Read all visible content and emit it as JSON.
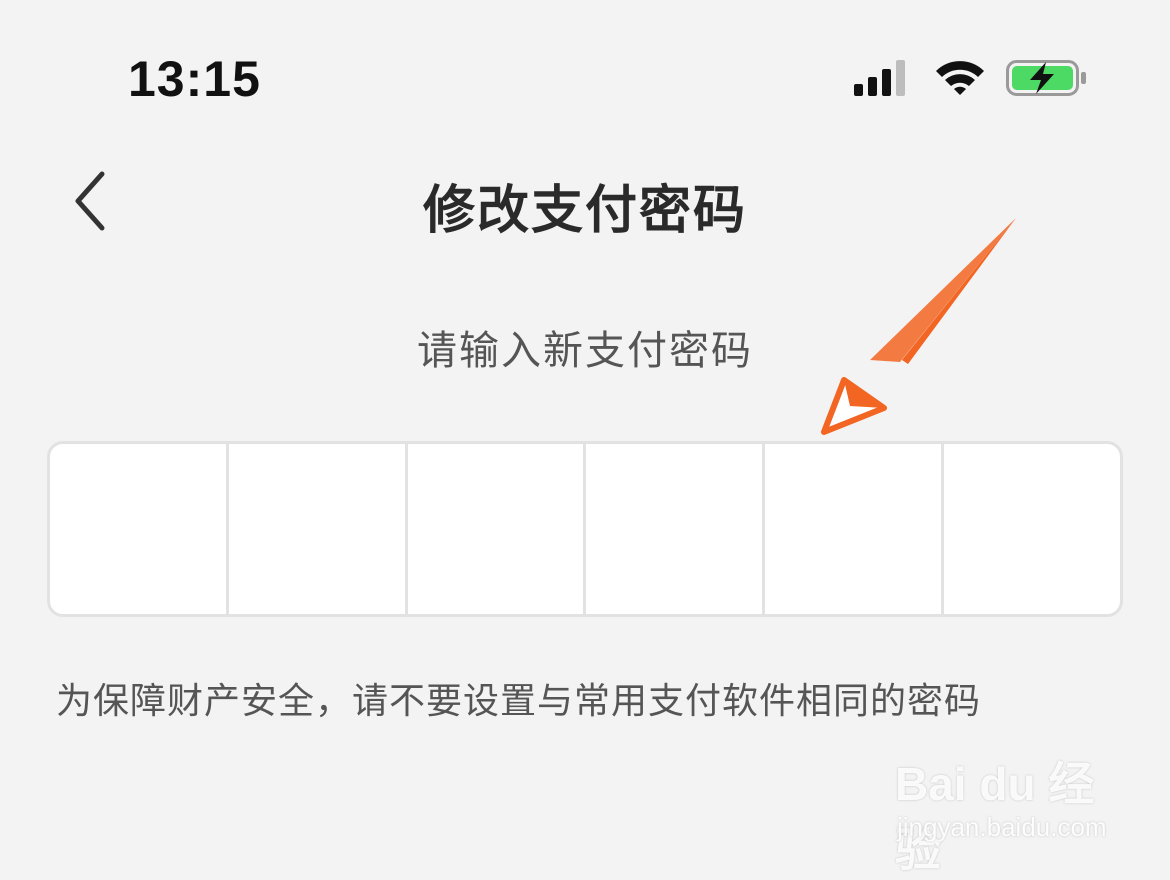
{
  "status_bar": {
    "time": "13:15",
    "icons": [
      "cellular-signal-icon",
      "wifi-icon",
      "battery-charging-icon"
    ],
    "battery_color": "#4cd964"
  },
  "nav": {
    "back_icon": "chevron-left-icon",
    "title": "修改支付密码"
  },
  "main": {
    "prompt": "请输入新支付密码",
    "pin_cells": [
      "",
      "",
      "",
      "",
      "",
      ""
    ],
    "warning": "为保障财产安全，请不要设置与常用支付软件相同的密码"
  },
  "annotation": {
    "arrow_color": "#f26522",
    "arrow_icon": "pointer-arrow-icon"
  },
  "watermark": {
    "logo": "Bai du 经验",
    "url": "jingyan.baidu.com"
  }
}
